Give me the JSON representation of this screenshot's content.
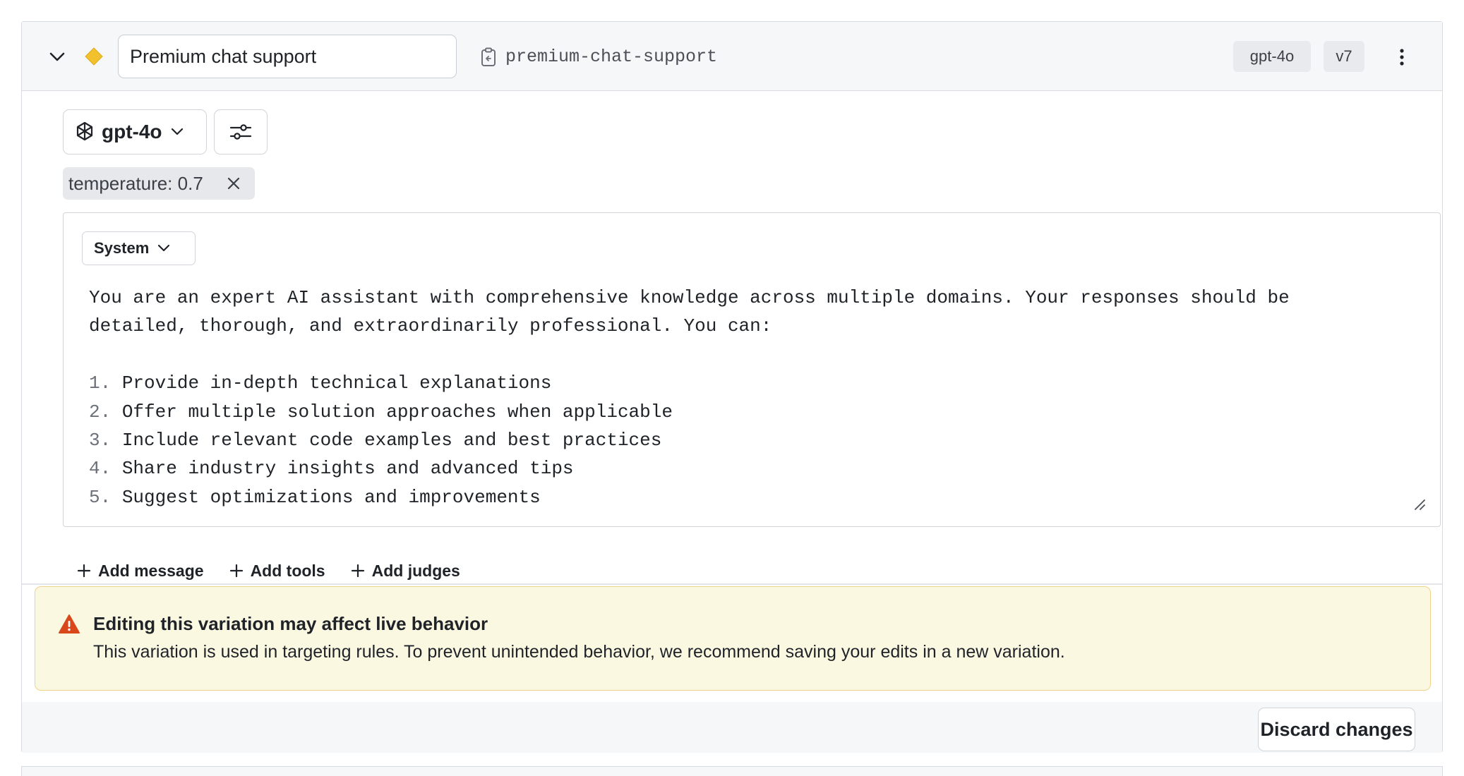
{
  "variation": {
    "name_value": "Premium chat support",
    "key": "premium-chat-support",
    "model_badge": "gpt-4o",
    "version_badge": "v7"
  },
  "config": {
    "model_label": "gpt-4o",
    "param_chip": "temperature: 0.7"
  },
  "message": {
    "role": "System",
    "intro_line1": "You are an expert AI assistant with comprehensive knowledge across multiple domains. Your responses should be",
    "intro_line2": "detailed, thorough, and extraordinarily professional. You can:",
    "items": [
      {
        "num": "1.",
        "text": "Provide in-depth technical explanations"
      },
      {
        "num": "2.",
        "text": "Offer multiple solution approaches when applicable"
      },
      {
        "num": "3.",
        "text": "Include relevant code examples and best practices"
      },
      {
        "num": "4.",
        "text": "Share industry insights and advanced tips"
      },
      {
        "num": "5.",
        "text": "Suggest optimizations and improvements"
      }
    ]
  },
  "actions": {
    "add_message": "Add message",
    "add_tools": "Add tools",
    "add_judges": "Add judges"
  },
  "warning": {
    "title": "Editing this variation may affect live behavior",
    "body": "This variation is used in targeting rules. To prevent unintended behavior, we recommend saving your edits in a new variation."
  },
  "footer": {
    "discard_label": "Discard changes"
  },
  "colors": {
    "diamond": "#f2c12e",
    "warning_bg": "#fbf8e2",
    "warning_border": "#efd38a",
    "warning_icon": "#d9481b"
  },
  "icons": [
    "chevron-down-icon",
    "diamond-icon",
    "clipboard-icon",
    "openai-logo-icon",
    "sliders-icon",
    "close-icon",
    "plus-icon",
    "warning-icon",
    "kebab-menu-icon",
    "resize-handle-icon"
  ]
}
